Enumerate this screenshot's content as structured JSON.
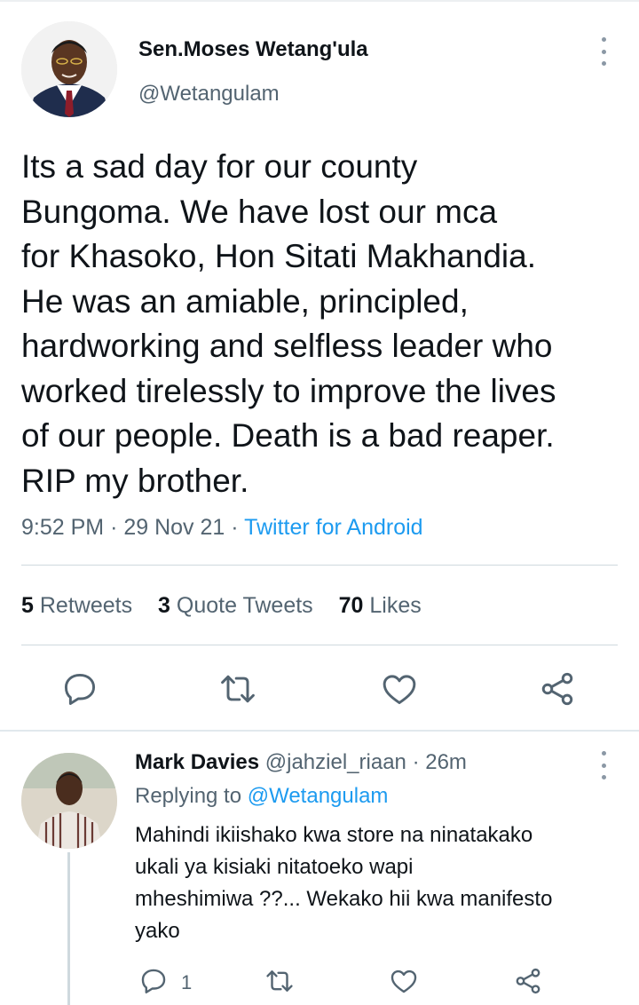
{
  "tweet": {
    "author": {
      "display_name": "Sen.Moses Wetang'ula",
      "handle": "@Wetangulam",
      "avatar": "avatar-photo"
    },
    "text_lines": [
      "Its a sad day for our county",
      "Bungoma. We have lost our mca",
      "for Khasoko, Hon Sitati Makhandia.",
      "He was an amiable, principled,",
      "hardworking and selfless leader who",
      "worked tirelessly to improve the lives",
      "of our people.  Death is a bad reaper.",
      "RIP my brother."
    ],
    "time": "9:52 PM",
    "separator": "·",
    "date": "29 Nov 21",
    "source": "Twitter for Android",
    "stats": {
      "retweets_count": "5",
      "retweets_label": "Retweets",
      "quotes_count": "3",
      "quotes_label": "Quote Tweets",
      "likes_count": "70",
      "likes_label": "Likes"
    },
    "actions": [
      "reply-icon",
      "retweet-icon",
      "like-icon",
      "share-icon"
    ]
  },
  "reply": {
    "author": {
      "display_name": "Mark Davies",
      "handle": "@jahziel_riaan",
      "separator": "·",
      "time": "26m",
      "avatar": "avatar-photo"
    },
    "replying_to_label": "Replying to",
    "replying_to_handle": "@Wetangulam",
    "text_lines": [
      "Mahindi ikiishako  kwa store na ninatakako",
      "ukali ya kisiaki nitatoeko wapi",
      "mheshimiwa ??... Wekako hii kwa manifesto",
      "yako"
    ],
    "reply_count": "1",
    "actions": [
      "reply-icon",
      "retweet-icon",
      "like-icon",
      "share-icon"
    ]
  },
  "colors": {
    "text": "#0f1419",
    "secondary": "#536471",
    "link": "#1d9bf0",
    "divider": "#cfd9de"
  }
}
